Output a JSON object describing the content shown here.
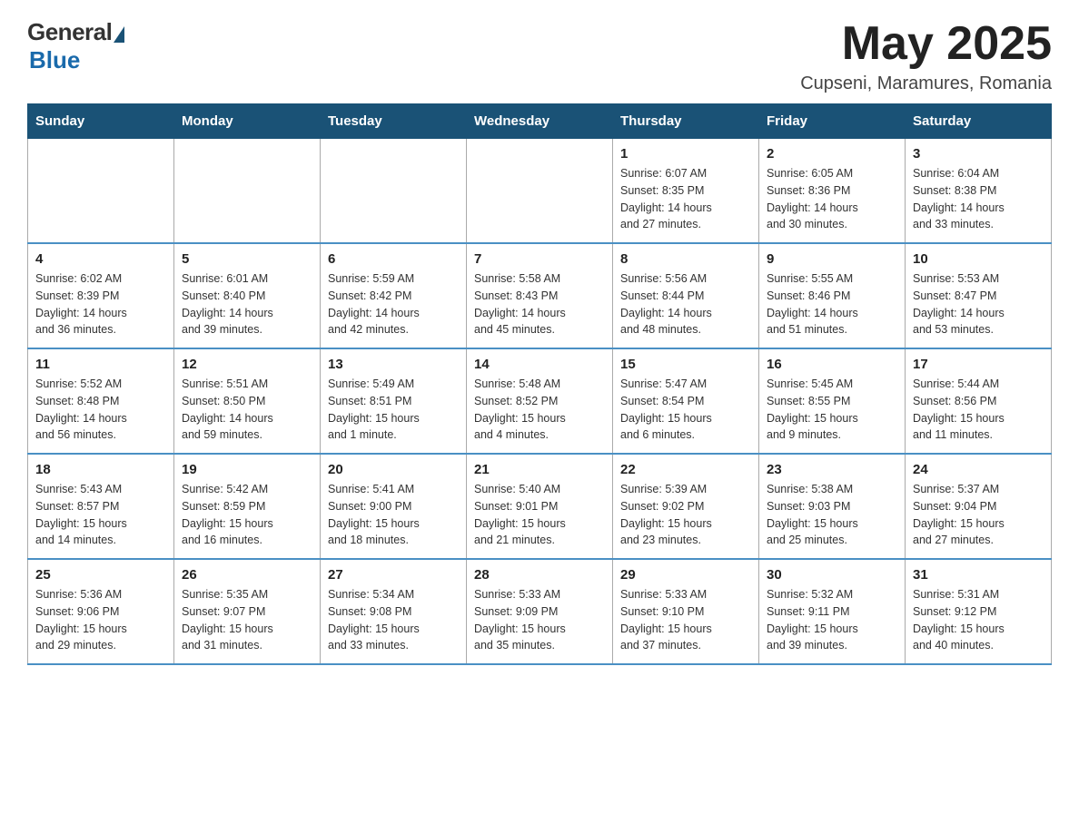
{
  "header": {
    "logo_general": "General",
    "logo_blue": "Blue",
    "month": "May 2025",
    "location": "Cupseni, Maramures, Romania"
  },
  "weekdays": [
    "Sunday",
    "Monday",
    "Tuesday",
    "Wednesday",
    "Thursday",
    "Friday",
    "Saturday"
  ],
  "weeks": [
    [
      {
        "day": "",
        "info": ""
      },
      {
        "day": "",
        "info": ""
      },
      {
        "day": "",
        "info": ""
      },
      {
        "day": "",
        "info": ""
      },
      {
        "day": "1",
        "info": "Sunrise: 6:07 AM\nSunset: 8:35 PM\nDaylight: 14 hours\nand 27 minutes."
      },
      {
        "day": "2",
        "info": "Sunrise: 6:05 AM\nSunset: 8:36 PM\nDaylight: 14 hours\nand 30 minutes."
      },
      {
        "day": "3",
        "info": "Sunrise: 6:04 AM\nSunset: 8:38 PM\nDaylight: 14 hours\nand 33 minutes."
      }
    ],
    [
      {
        "day": "4",
        "info": "Sunrise: 6:02 AM\nSunset: 8:39 PM\nDaylight: 14 hours\nand 36 minutes."
      },
      {
        "day": "5",
        "info": "Sunrise: 6:01 AM\nSunset: 8:40 PM\nDaylight: 14 hours\nand 39 minutes."
      },
      {
        "day": "6",
        "info": "Sunrise: 5:59 AM\nSunset: 8:42 PM\nDaylight: 14 hours\nand 42 minutes."
      },
      {
        "day": "7",
        "info": "Sunrise: 5:58 AM\nSunset: 8:43 PM\nDaylight: 14 hours\nand 45 minutes."
      },
      {
        "day": "8",
        "info": "Sunrise: 5:56 AM\nSunset: 8:44 PM\nDaylight: 14 hours\nand 48 minutes."
      },
      {
        "day": "9",
        "info": "Sunrise: 5:55 AM\nSunset: 8:46 PM\nDaylight: 14 hours\nand 51 minutes."
      },
      {
        "day": "10",
        "info": "Sunrise: 5:53 AM\nSunset: 8:47 PM\nDaylight: 14 hours\nand 53 minutes."
      }
    ],
    [
      {
        "day": "11",
        "info": "Sunrise: 5:52 AM\nSunset: 8:48 PM\nDaylight: 14 hours\nand 56 minutes."
      },
      {
        "day": "12",
        "info": "Sunrise: 5:51 AM\nSunset: 8:50 PM\nDaylight: 14 hours\nand 59 minutes."
      },
      {
        "day": "13",
        "info": "Sunrise: 5:49 AM\nSunset: 8:51 PM\nDaylight: 15 hours\nand 1 minute."
      },
      {
        "day": "14",
        "info": "Sunrise: 5:48 AM\nSunset: 8:52 PM\nDaylight: 15 hours\nand 4 minutes."
      },
      {
        "day": "15",
        "info": "Sunrise: 5:47 AM\nSunset: 8:54 PM\nDaylight: 15 hours\nand 6 minutes."
      },
      {
        "day": "16",
        "info": "Sunrise: 5:45 AM\nSunset: 8:55 PM\nDaylight: 15 hours\nand 9 minutes."
      },
      {
        "day": "17",
        "info": "Sunrise: 5:44 AM\nSunset: 8:56 PM\nDaylight: 15 hours\nand 11 minutes."
      }
    ],
    [
      {
        "day": "18",
        "info": "Sunrise: 5:43 AM\nSunset: 8:57 PM\nDaylight: 15 hours\nand 14 minutes."
      },
      {
        "day": "19",
        "info": "Sunrise: 5:42 AM\nSunset: 8:59 PM\nDaylight: 15 hours\nand 16 minutes."
      },
      {
        "day": "20",
        "info": "Sunrise: 5:41 AM\nSunset: 9:00 PM\nDaylight: 15 hours\nand 18 minutes."
      },
      {
        "day": "21",
        "info": "Sunrise: 5:40 AM\nSunset: 9:01 PM\nDaylight: 15 hours\nand 21 minutes."
      },
      {
        "day": "22",
        "info": "Sunrise: 5:39 AM\nSunset: 9:02 PM\nDaylight: 15 hours\nand 23 minutes."
      },
      {
        "day": "23",
        "info": "Sunrise: 5:38 AM\nSunset: 9:03 PM\nDaylight: 15 hours\nand 25 minutes."
      },
      {
        "day": "24",
        "info": "Sunrise: 5:37 AM\nSunset: 9:04 PM\nDaylight: 15 hours\nand 27 minutes."
      }
    ],
    [
      {
        "day": "25",
        "info": "Sunrise: 5:36 AM\nSunset: 9:06 PM\nDaylight: 15 hours\nand 29 minutes."
      },
      {
        "day": "26",
        "info": "Sunrise: 5:35 AM\nSunset: 9:07 PM\nDaylight: 15 hours\nand 31 minutes."
      },
      {
        "day": "27",
        "info": "Sunrise: 5:34 AM\nSunset: 9:08 PM\nDaylight: 15 hours\nand 33 minutes."
      },
      {
        "day": "28",
        "info": "Sunrise: 5:33 AM\nSunset: 9:09 PM\nDaylight: 15 hours\nand 35 minutes."
      },
      {
        "day": "29",
        "info": "Sunrise: 5:33 AM\nSunset: 9:10 PM\nDaylight: 15 hours\nand 37 minutes."
      },
      {
        "day": "30",
        "info": "Sunrise: 5:32 AM\nSunset: 9:11 PM\nDaylight: 15 hours\nand 39 minutes."
      },
      {
        "day": "31",
        "info": "Sunrise: 5:31 AM\nSunset: 9:12 PM\nDaylight: 15 hours\nand 40 minutes."
      }
    ]
  ]
}
